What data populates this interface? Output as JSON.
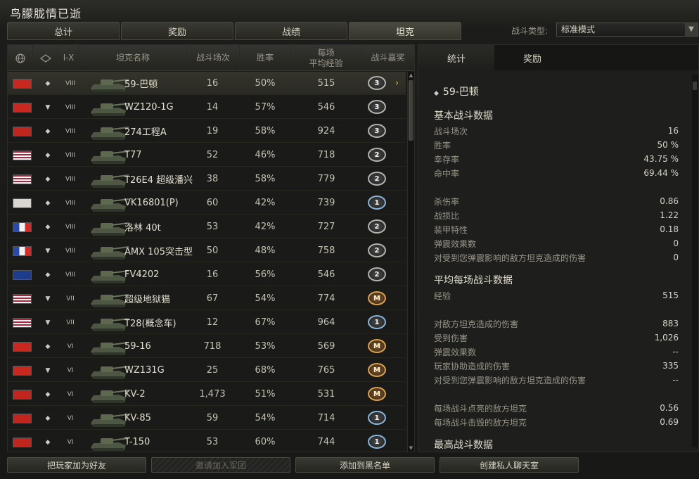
{
  "window": {
    "title": "鸟朦胧情已逝"
  },
  "tabs": [
    "总计",
    "奖励",
    "战绩",
    "坦克"
  ],
  "battle_type": {
    "label": "战斗类型:",
    "value": "标准模式"
  },
  "table": {
    "headers": {
      "tier": "I-X",
      "name": "坦克名称",
      "battles": "战斗场次",
      "wins": "胜率",
      "avgxp_1": "每场",
      "avgxp_2": "平均经验",
      "mastery": "战斗嘉奖"
    },
    "rows": [
      {
        "flag": "cn",
        "type": "◆",
        "tier": "VIII",
        "name": "59-巴顿",
        "battles": "16",
        "wins": "50%",
        "avgxp": "515",
        "mastery": "3"
      },
      {
        "flag": "cn",
        "type": "▼",
        "tier": "VIII",
        "name": "WZ120-1G",
        "battles": "14",
        "wins": "57%",
        "avgxp": "546",
        "mastery": "3"
      },
      {
        "flag": "su",
        "type": "◆",
        "tier": "VIII",
        "name": "274工程A",
        "battles": "19",
        "wins": "58%",
        "avgxp": "924",
        "mastery": "3"
      },
      {
        "flag": "us",
        "type": "◆",
        "tier": "VIII",
        "name": "T77",
        "battles": "52",
        "wins": "46%",
        "avgxp": "718",
        "mastery": "2"
      },
      {
        "flag": "us",
        "type": "◆",
        "tier": "VIII",
        "name": "T26E4 超级潘兴",
        "battles": "38",
        "wins": "58%",
        "avgxp": "779",
        "mastery": "2"
      },
      {
        "flag": "de",
        "type": "◆",
        "tier": "VIII",
        "name": "VK16801(P)",
        "battles": "60",
        "wins": "42%",
        "avgxp": "739",
        "mastery": "1"
      },
      {
        "flag": "fr",
        "type": "◆",
        "tier": "VIII",
        "name": "洛林 40t",
        "battles": "53",
        "wins": "42%",
        "avgxp": "727",
        "mastery": "2"
      },
      {
        "flag": "fr",
        "type": "▼",
        "tier": "VIII",
        "name": "AMX 105突击型",
        "battles": "50",
        "wins": "48%",
        "avgxp": "758",
        "mastery": "2"
      },
      {
        "flag": "uk",
        "type": "◆",
        "tier": "VIII",
        "name": "FV4202",
        "battles": "16",
        "wins": "56%",
        "avgxp": "546",
        "mastery": "2"
      },
      {
        "flag": "us",
        "type": "▼",
        "tier": "VII",
        "name": "超级地狱猫",
        "battles": "67",
        "wins": "54%",
        "avgxp": "774",
        "mastery": "M"
      },
      {
        "flag": "us",
        "type": "▼",
        "tier": "VII",
        "name": "T28(概念车)",
        "battles": "12",
        "wins": "67%",
        "avgxp": "964",
        "mastery": "1"
      },
      {
        "flag": "cn",
        "type": "◆",
        "tier": "VI",
        "name": "59-16",
        "battles": "718",
        "wins": "53%",
        "avgxp": "569",
        "mastery": "M"
      },
      {
        "flag": "cn",
        "type": "▼",
        "tier": "VI",
        "name": "WZ131G",
        "battles": "25",
        "wins": "68%",
        "avgxp": "765",
        "mastery": "M"
      },
      {
        "flag": "su",
        "type": "◆",
        "tier": "VI",
        "name": "KV-2",
        "battles": "1,473",
        "wins": "51%",
        "avgxp": "531",
        "mastery": "M"
      },
      {
        "flag": "su",
        "type": "◆",
        "tier": "VI",
        "name": "KV-85",
        "battles": "59",
        "wins": "54%",
        "avgxp": "714",
        "mastery": "1"
      },
      {
        "flag": "su",
        "type": "◆",
        "tier": "VI",
        "name": "T-150",
        "battles": "53",
        "wins": "60%",
        "avgxp": "744",
        "mastery": "1"
      }
    ]
  },
  "panel": {
    "tabs": [
      "统计",
      "奖励"
    ],
    "tank_name": "59-巴顿",
    "sections": [
      {
        "title": "基本战斗数据",
        "rows": [
          [
            "战斗场次",
            "16"
          ],
          [
            "胜率",
            "50 %"
          ],
          [
            "幸存率",
            "43.75 %"
          ],
          [
            "命中率",
            "69.44 %"
          ],
          [
            "",
            ""
          ],
          [
            "杀伤率",
            "0.86"
          ],
          [
            "战损比",
            "1.22"
          ],
          [
            "装甲特性",
            "0.18"
          ],
          [
            "弹震效果数",
            "0"
          ],
          [
            "对受到您弹震影响的敌方坦克造成的伤害",
            "0"
          ]
        ]
      },
      {
        "title": "平均每场战斗数据",
        "rows": [
          [
            "经验",
            "515"
          ],
          [
            "",
            ""
          ],
          [
            "对敌方坦克造成的伤害",
            "883"
          ],
          [
            "受到伤害",
            "1,026"
          ],
          [
            "弹震效果数",
            "--"
          ],
          [
            "玩家协助造成的伤害",
            "335"
          ],
          [
            "对受到您弹震影响的敌方坦克造成的伤害",
            "--"
          ],
          [
            "",
            ""
          ],
          [
            "每场战斗点亮的敌方坦克",
            "0.56"
          ],
          [
            "每场战斗击毁的敌方坦克",
            "0.69"
          ]
        ]
      },
      {
        "title": "最高战斗数据",
        "rows": []
      }
    ]
  },
  "bottom_buttons": [
    "把玩家加为好友",
    "邀请加入军团",
    "添加到黑名单",
    "创建私人聊天室"
  ],
  "colors": {
    "accent": "#e8b040",
    "mastery_gold": "#d8a050"
  }
}
